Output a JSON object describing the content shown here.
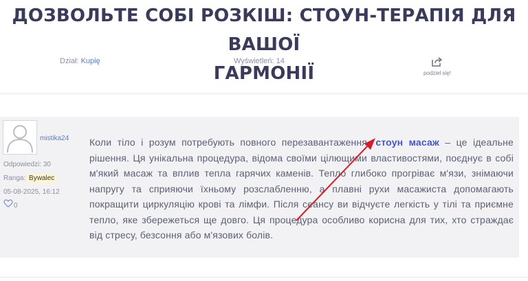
{
  "page": {
    "title_line1": "ДОЗВОЛЬТЕ СОБІ РОЗКІШ: СТОУН-ТЕРАПІЯ ДЛЯ ВАШОЇ",
    "title_line2": "ГАРМОНІЇ"
  },
  "meta": {
    "section_label": "Dział:",
    "section_value": "Kupię",
    "views_label": "Wyświetleń:",
    "views_value": "14",
    "share_label": "podziel się!",
    "share_icon": "share-icon"
  },
  "author": {
    "username": "mistika24",
    "replies_label": "Odpowiedzi:",
    "replies_value": "30",
    "rank_label": "Ranga:",
    "rank_value": "Bywalec",
    "date": "05-08-2025, 16:12",
    "likes_count": "0",
    "avatar_icon": "user-avatar-icon",
    "like_icon": "heart-icon"
  },
  "post": {
    "text_before": "Коли тіло і розум потребують повного перезавантаження, ",
    "keyword": "стоун масаж",
    "text_after": " – це ідеальне рішення. Ця унікальна процедура, відома своїми цілющими властивостями, поєднує в собі м'який масаж та вплив тепла гарячих каменів. Тепло глибоко прогріває м'язи, знімаючи напругу та сприяючи їхньому розслабленню, а плавні рухи масажиста допомагають покращити циркуляцію крові та лімфи. Після сеансу ви відчуєте легкість у тілі та приємне тепло, яке збережеться ще довго. Ця процедура особливо корисна для тих, хто страждає від стресу, безсоння або м'язових болів."
  },
  "colors": {
    "annotation_arrow": "#d41f2a",
    "link": "#4355cc",
    "title": "#3a3a5a"
  }
}
